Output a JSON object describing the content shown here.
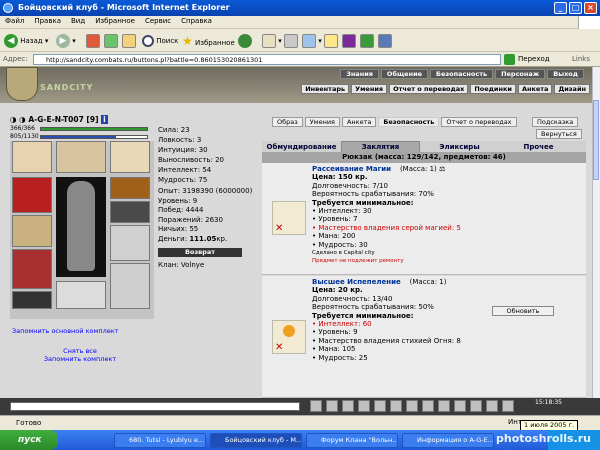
{
  "window": {
    "title": "Бойцовский клуб - Microsoft Internet Explorer"
  },
  "menu": [
    "Файл",
    "Правка",
    "Вид",
    "Избранное",
    "Сервис",
    "Справка"
  ],
  "toolbar": {
    "back": "Назад",
    "search": "Поиск",
    "favorites": "Избранное"
  },
  "address": {
    "label": "Адрес:",
    "url": "http://sandcity.combats.ru/buttons.pl?battle=0.860153020861301",
    "go": "Переход",
    "links": "Links"
  },
  "site": {
    "logo": "SANDCITY",
    "topnav": [
      "Знания",
      "Общение",
      "Безопасность",
      "Персонаж",
      "Выход"
    ],
    "subnav": [
      "Инвентарь",
      "Умения",
      "Отчет о переводах",
      "Поединки",
      "Анкета",
      "Дизайн"
    ]
  },
  "character": {
    "name": "A-G-E-N-T007",
    "level": "[9]",
    "hp": "366/366",
    "mana": "805/1130",
    "hp_fill": 1.0,
    "mana_fill": 0.71,
    "stats": [
      "Сила: 23",
      "Ловкость: 3",
      "Интуиция: 30",
      "Выносливость: 20",
      "Интеллект: 54",
      "Мудрость: 75"
    ],
    "stats2": [
      "Опыт: 3198390 (6000000)",
      "Уровень: 9",
      "Побед: 4444",
      "Поражений: 2630",
      "Ничьих: 55"
    ],
    "money_label": "Деньги:",
    "money_value": "111.05",
    "money_unit": "кр.",
    "return": "Возврат",
    "clan": "Клан: Volnye",
    "remember_main": "Запомнить основной комплект",
    "remove_all": "Снять все",
    "remember_set": "Запомнить комплект"
  },
  "tabs": {
    "buttons": [
      "Образ",
      "Умения",
      "Анкета",
      "Безопасность",
      "Отчет о переводах"
    ],
    "hint": "Подсказка",
    "back": "Вернуться",
    "categories": [
      "Обмундирование",
      "Заклятия",
      "Эликсиры",
      "Прочее"
    ],
    "backpack": "Рюкзак (масса: 129/142, предметов: 46)"
  },
  "items": [
    {
      "name": "Рассеивание Магии",
      "mass": "(Масса: 1)",
      "price": "Цена: 150 кр.",
      "durability": "Долговечность: 7/10",
      "chance": "Вероятность срабатывания: 70%",
      "req": "Требуется минимальное:",
      "reqs": [
        {
          "t": "Интеллект: 30",
          "red": false
        },
        {
          "t": "Уровень: 7",
          "red": false
        },
        {
          "t": "Мастерство владения серой магией: 5",
          "red": true
        },
        {
          "t": "Мана: 200",
          "red": false
        },
        {
          "t": "Мудрость: 30",
          "red": false
        }
      ],
      "note1": "Сделано в Capital city",
      "note2": "Предмет не подлежит ремонту"
    },
    {
      "name": "Высшее Испепеление",
      "mass": "(Масса: 1)",
      "price": "Цена: 20 кр.",
      "durability": "Долговечность: 13/40",
      "chance": "Вероятность срабатывания: 50%",
      "req": "Требуется минимальное:",
      "reqs": [
        {
          "t": "Интеллект: 60",
          "red": true
        },
        {
          "t": "Уровень: 9",
          "red": false
        },
        {
          "t": "Мастерство владения стихией Огня: 8",
          "red": false
        },
        {
          "t": "Мана: 105",
          "red": false
        },
        {
          "t": "Мудрость: 25",
          "red": false
        }
      ]
    }
  ],
  "update": "Обновить",
  "clock": "15:18:35",
  "status": {
    "ready": "Готово",
    "zone": "Интернет",
    "date": "1 июля 2005 г."
  },
  "taskbar": {
    "start": "пуск",
    "tasks": [
      "680. Tutsi - Lyublyu e...",
      "Бойцовский клуб - M...",
      "Форум Клана \"Вольн...",
      "Информация о A-G-E..."
    ]
  },
  "watermark": "photoshrolls.ru"
}
